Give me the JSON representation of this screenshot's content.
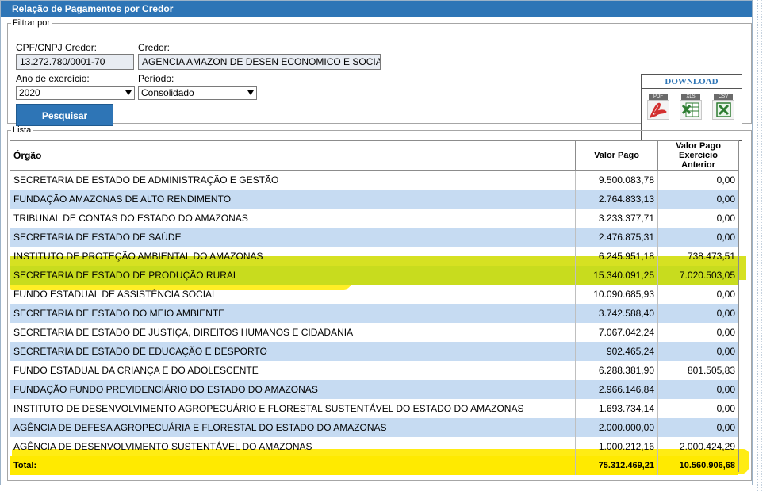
{
  "header": {
    "title": "Relação de Pagamentos por Credor"
  },
  "filter": {
    "legend": "Filtrar por",
    "cpf_label": "CPF/CNPJ Credor:",
    "cpf_value": "13.272.780/0001-70",
    "credor_label": "Credor:",
    "credor_value": "AGENCIA AMAZON DE DESEN ECONOMICO E SOCIAL- A",
    "ano_label": "Ano de exercício:",
    "ano_value": "2020",
    "periodo_label": "Período:",
    "periodo_value": "Consolidado",
    "search_button": "Pesquisar"
  },
  "download": {
    "title": "DOWNLOAD",
    "items": [
      {
        "label": "PDF",
        "icon": "pdf-icon",
        "color": "#d32f2f"
      },
      {
        "label": "XLS",
        "icon": "xls-icon",
        "color": "#2e7d32"
      },
      {
        "label": "CSV",
        "icon": "csv-icon",
        "color": "#2e7d32"
      }
    ]
  },
  "list": {
    "legend": "Lista",
    "columns": {
      "orgao": "Órgão",
      "valor_pago": "Valor Pago",
      "valor_anterior": "Valor Pago Exercício Anterior"
    },
    "rows": [
      {
        "orgao": "SECRETARIA DE ESTADO DE ADMINISTRAÇÃO E GESTÃO",
        "valor_pago": "9.500.083,78",
        "valor_anterior": "0,00"
      },
      {
        "orgao": "FUNDAÇÃO AMAZONAS DE ALTO RENDIMENTO",
        "valor_pago": "2.764.833,13",
        "valor_anterior": "0,00"
      },
      {
        "orgao": "TRIBUNAL DE CONTAS DO ESTADO DO AMAZONAS",
        "valor_pago": "3.233.377,71",
        "valor_anterior": "0,00"
      },
      {
        "orgao": "SECRETARIA DE ESTADO DE SAÚDE",
        "valor_pago": "2.476.875,31",
        "valor_anterior": "0,00"
      },
      {
        "orgao": "INSTITUTO DE PROTEÇÃO AMBIENTAL DO AMAZONAS",
        "valor_pago": "6.245.951,18",
        "valor_anterior": "738.473,51"
      },
      {
        "orgao": "SECRETARIA DE ESTADO DE PRODUÇÃO RURAL",
        "valor_pago": "15.340.091,25",
        "valor_anterior": "7.020.503,05"
      },
      {
        "orgao": "FUNDO ESTADUAL DE ASSISTÊNCIA SOCIAL",
        "valor_pago": "10.090.685,93",
        "valor_anterior": "0,00"
      },
      {
        "orgao": "SECRETARIA DE ESTADO DO MEIO AMBIENTE",
        "valor_pago": "3.742.588,40",
        "valor_anterior": "0,00"
      },
      {
        "orgao": "SECRETARIA DE ESTADO DE JUSTIÇA, DIREITOS HUMANOS E CIDADANIA",
        "valor_pago": "7.067.042,24",
        "valor_anterior": "0,00"
      },
      {
        "orgao": "SECRETARIA DE ESTADO DE EDUCAÇÃO E DESPORTO",
        "valor_pago": "902.465,24",
        "valor_anterior": "0,00"
      },
      {
        "orgao": "FUNDO ESTADUAL DA CRIANÇA E DO ADOLESCENTE",
        "valor_pago": "6.288.381,90",
        "valor_anterior": "801.505,83"
      },
      {
        "orgao": "FUNDAÇÃO FUNDO PREVIDENCIÁRIO DO ESTADO DO AMAZONAS",
        "valor_pago": "2.966.146,84",
        "valor_anterior": "0,00"
      },
      {
        "orgao": "INSTITUTO DE DESENVOLVIMENTO AGROPECUÁRIO E FLORESTAL SUSTENTÁVEL DO ESTADO DO AMAZONAS",
        "valor_pago": "1.693.734,14",
        "valor_anterior": "0,00"
      },
      {
        "orgao": "AGÊNCIA DE DEFESA AGROPECUÁRIA E FLORESTAL DO ESTADO DO AMAZONAS",
        "valor_pago": "2.000.000,00",
        "valor_anterior": "0,00"
      },
      {
        "orgao": "AGÊNCIA DE DESENVOLVIMENTO SUSTENTÁVEL DO AMAZONAS",
        "valor_pago": "1.000.212,16",
        "valor_anterior": "2.000.424,29"
      }
    ],
    "total": {
      "label": "Total:",
      "valor_pago": "75.312.469,21",
      "valor_anterior": "10.560.906,68"
    }
  }
}
